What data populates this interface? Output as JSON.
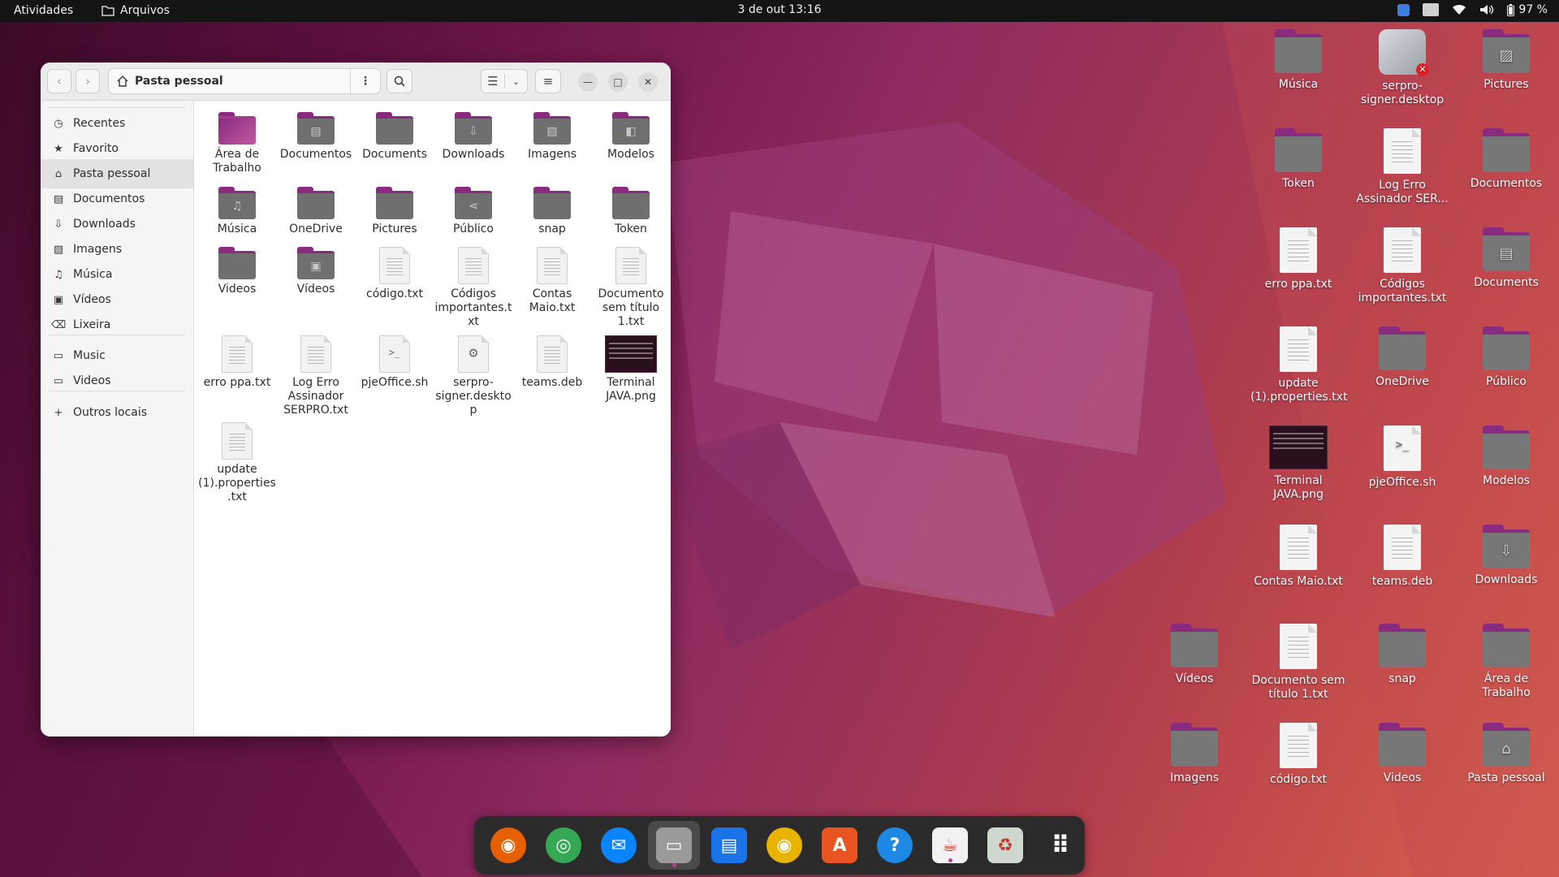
{
  "topbar": {
    "activities": "Atividades",
    "app_menu": "Arquivos",
    "clock": "3 de out  13:16",
    "battery": "97 %"
  },
  "window": {
    "path": "Pasta pessoal",
    "sidebar": [
      {
        "label": "Recentes",
        "icon": "clock-icon"
      },
      {
        "label": "Favorito",
        "icon": "star-icon"
      },
      {
        "label": "Pasta pessoal",
        "icon": "home-icon",
        "active": true
      },
      {
        "label": "Documentos",
        "icon": "document-icon"
      },
      {
        "label": "Downloads",
        "icon": "download-icon"
      },
      {
        "label": "Imagens",
        "icon": "image-icon"
      },
      {
        "label": "Música",
        "icon": "music-icon"
      },
      {
        "label": "Vídeos",
        "icon": "video-icon"
      },
      {
        "label": "Lixeira",
        "icon": "trash-icon"
      },
      {
        "label": "Music",
        "icon": "folder-icon"
      },
      {
        "label": "Videos",
        "icon": "folder-icon"
      },
      {
        "label": "Outros locais",
        "icon": "plus-icon"
      }
    ],
    "files": [
      {
        "label": "Área de Trabalho",
        "type": "folder-desktop"
      },
      {
        "label": "Documentos",
        "type": "folder",
        "glyph": "document-icon"
      },
      {
        "label": "Documents",
        "type": "folder"
      },
      {
        "label": "Downloads",
        "type": "folder",
        "glyph": "download-icon"
      },
      {
        "label": "Imagens",
        "type": "folder",
        "glyph": "image-icon"
      },
      {
        "label": "Modelos",
        "type": "folder",
        "glyph": "template-icon"
      },
      {
        "label": "Música",
        "type": "folder",
        "glyph": "music-icon"
      },
      {
        "label": "OneDrive",
        "type": "folder"
      },
      {
        "label": "Pictures",
        "type": "folder"
      },
      {
        "label": "Público",
        "type": "folder",
        "glyph": "share-icon"
      },
      {
        "label": "snap",
        "type": "folder"
      },
      {
        "label": "Token",
        "type": "folder"
      },
      {
        "label": "Videos",
        "type": "folder"
      },
      {
        "label": "Vídeos",
        "type": "folder",
        "glyph": "video-icon"
      },
      {
        "label": "código.txt",
        "type": "text"
      },
      {
        "label": "Códigos importantes.txt",
        "type": "text"
      },
      {
        "label": "Contas Maio.txt",
        "type": "text"
      },
      {
        "label": "Documento sem título 1.txt",
        "type": "text"
      },
      {
        "label": "erro ppa.txt",
        "type": "text"
      },
      {
        "label": "Log Erro Assinador SERPRO.txt",
        "type": "text"
      },
      {
        "label": "pjeOffice.sh",
        "type": "script"
      },
      {
        "label": "serpro-signer.desktop",
        "type": "desktop"
      },
      {
        "label": "teams.deb",
        "type": "text"
      },
      {
        "label": "Terminal JAVA.png",
        "type": "image"
      },
      {
        "label": "update (1).properties.txt",
        "type": "text"
      }
    ]
  },
  "desktop_icons": [
    {
      "label": "Música",
      "type": "folder"
    },
    {
      "label": "serpro-signer.desktop",
      "type": "signer"
    },
    {
      "label": "Pictures",
      "type": "folder",
      "glyph": "image-icon"
    },
    {
      "label": "Token",
      "type": "folder"
    },
    {
      "label": "Log Erro Assinador SER...",
      "type": "text"
    },
    {
      "label": "Documentos",
      "type": "folder"
    },
    {
      "label": "erro ppa.txt",
      "type": "text"
    },
    {
      "label": "Códigos importantes.txt",
      "type": "text"
    },
    {
      "label": "Documents",
      "type": "folder",
      "glyph": "document-icon"
    },
    {
      "label": "update (1).properties.txt",
      "type": "text"
    },
    {
      "label": "OneDrive",
      "type": "folder"
    },
    {
      "label": "Público",
      "type": "folder"
    },
    {
      "label": "Terminal JAVA.png",
      "type": "image"
    },
    {
      "label": "pjeOffice.sh",
      "type": "script"
    },
    {
      "label": "Modelos",
      "type": "folder"
    },
    {
      "label": "Contas Maio.txt",
      "type": "text"
    },
    {
      "label": "teams.deb",
      "type": "text"
    },
    {
      "label": "Downloads",
      "type": "folder",
      "glyph": "download-icon"
    },
    {
      "label": "Vídeos",
      "type": "folder"
    },
    {
      "label": "Documento sem título 1.txt",
      "type": "text"
    },
    {
      "label": "snap",
      "type": "folder"
    },
    {
      "label": "Área de Trabalho",
      "type": "folder"
    },
    {
      "label": "Imagens",
      "type": "folder"
    },
    {
      "label": "código.txt",
      "type": "text"
    },
    {
      "label": "Videos",
      "type": "folder"
    },
    {
      "label": "Pasta pessoal",
      "type": "folder",
      "glyph": "home-icon"
    }
  ],
  "dock": [
    {
      "name": "firefox-icon",
      "color": "#e66000",
      "running": false
    },
    {
      "name": "chrome-icon",
      "color": "#34a853",
      "running": false
    },
    {
      "name": "thunderbird-icon",
      "color": "#0a84ff",
      "running": false
    },
    {
      "name": "files-icon",
      "color": "#9a9a9a",
      "running": true,
      "highlighted": true
    },
    {
      "name": "writer-icon",
      "color": "#1a73e8",
      "running": false
    },
    {
      "name": "rhythmbox-icon",
      "color": "#e8b400",
      "running": false
    },
    {
      "name": "software-center-icon",
      "color": "#e95420",
      "running": false
    },
    {
      "name": "help-icon",
      "color": "#1e88e5",
      "running": false
    },
    {
      "name": "java-icon",
      "color": "#f2f2f2",
      "running": true
    },
    {
      "name": "trash-icon",
      "color": "#cfd8cf",
      "running": false
    },
    {
      "name": "app-grid-icon",
      "color": "#ffffff",
      "running": false
    }
  ],
  "colors": {
    "accent": "#8a2b7f",
    "topbar": "#141414",
    "dock": "#2b2b2b"
  }
}
